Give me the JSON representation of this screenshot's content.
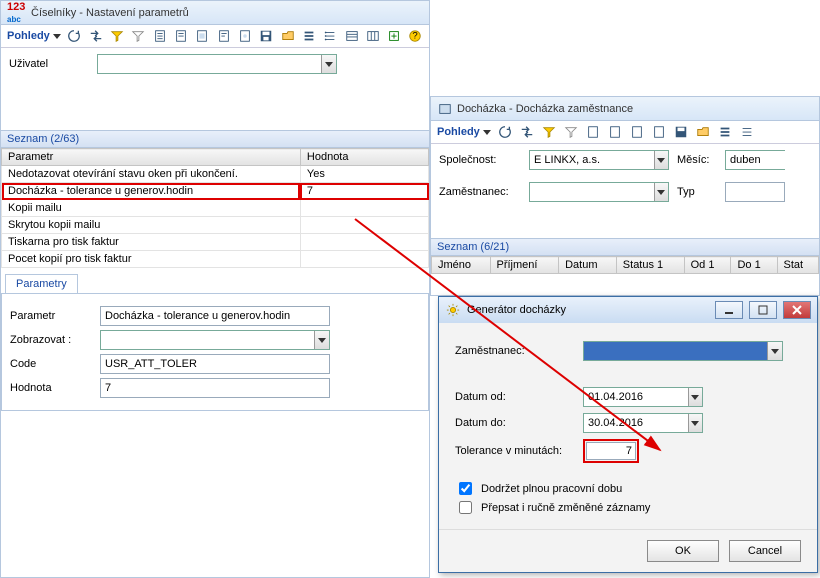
{
  "main": {
    "title": "Číselníky - Nastavení parametrů",
    "menu": "Pohledy",
    "user_label": "Uživatel",
    "user_value": "",
    "seznam_head": "Seznam (2/63)",
    "col_param": "Parametr",
    "col_hodnota": "Hodnota",
    "rows": [
      {
        "p": "Nedotazovat otevírání stavu oken při ukončení.",
        "h": "Yes"
      },
      {
        "p": "Docházka - tolerance u generov.hodin",
        "h": "7"
      },
      {
        "p": "Kopii mailu",
        "h": ""
      },
      {
        "p": "Skrytou kopii mailu",
        "h": ""
      },
      {
        "p": "Tiskarna pro tisk faktur",
        "h": ""
      },
      {
        "p": "Pocet kopií pro tisk faktur",
        "h": ""
      }
    ],
    "tab": "Parametry",
    "f_param": "Parametr",
    "f_param_v": "Docházka - tolerance u generov.hodin",
    "f_zobr": "Zobrazovat :",
    "f_zobr_v": "",
    "f_code": "Code",
    "f_code_v": "USR_ATT_TOLER",
    "f_hod": "Hodnota",
    "f_hod_v": "7"
  },
  "sec": {
    "title": "Docházka - Docházka zaměstnance",
    "menu": "Pohledy",
    "spolecnost_l": "Společnost:",
    "spolecnost_v": "E LINKX, a.s.",
    "mesic_l": "Měsíc:",
    "mesic_v": "duben",
    "zam_l": "Zaměstnanec:",
    "zam_v": "",
    "typ_l": "Typ",
    "typ_v": "",
    "seznam_head": "Seznam (6/21)",
    "cols": [
      "Jméno",
      "Příjmení",
      "Datum",
      "Status 1",
      "Od 1",
      "Do 1",
      "Stat"
    ]
  },
  "dlg": {
    "title": "Generátor docházky",
    "zam_l": "Zaměstnanec:",
    "zam_v": "",
    "datum_od_l": "Datum od:",
    "datum_od_v": "01.04.2016",
    "datum_do_l": "Datum do:",
    "datum_do_v": "30.04.2016",
    "tol_l": "Tolerance v minutách:",
    "tol_v": "7",
    "chk1": "Dodržet plnou pracovní dobu",
    "chk2": "Přepsat i ručně změněné záznamy",
    "ok": "OK",
    "cancel": "Cancel"
  },
  "icons": {
    "refresh": "↻",
    "arrows": "⇆",
    "filter": "▽",
    "doc": "▤",
    "folder": "📂"
  }
}
